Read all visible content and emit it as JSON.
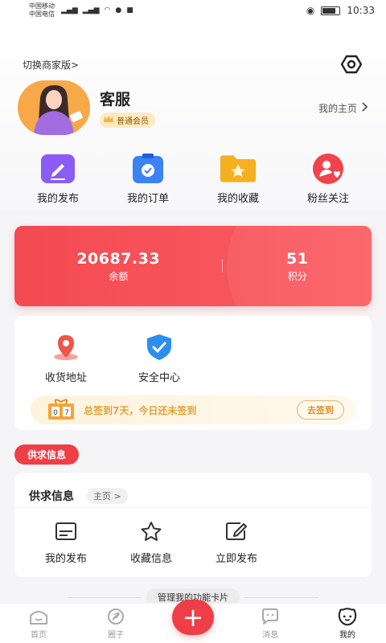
{
  "statusbar": {
    "carrier1": "中国移动",
    "carrier2": "中国电信",
    "time": "10:33"
  },
  "header": {
    "switch_label": "切换商家版>",
    "settings_icon": "settings-hexagon-icon"
  },
  "profile": {
    "name": "客服",
    "level": "普通会员",
    "home_link": "我的主页"
  },
  "quick": [
    {
      "label": "我的发布",
      "icon": "edit-icon",
      "color": "#8b5cf6"
    },
    {
      "label": "我的订单",
      "icon": "order-clipboard-icon",
      "color": "#3b82f6"
    },
    {
      "label": "我的收藏",
      "icon": "star-folder-icon",
      "color": "#f5b021"
    },
    {
      "label": "粉丝关注",
      "icon": "fans-heart-icon",
      "color": "#f0434b"
    }
  ],
  "wallet": {
    "balance_value": "20687.33",
    "balance_label": "余额",
    "points_value": "51",
    "points_label": "积分",
    "color": "#f44a52"
  },
  "services": [
    {
      "label": "收货地址",
      "icon": "location-pin-icon"
    },
    {
      "label": "安全中心",
      "icon": "shield-check-icon"
    }
  ],
  "signin": {
    "days_digits": "07",
    "text": "总签到7天，今日还未签到",
    "button": "去签到"
  },
  "section_tag": "供求信息",
  "supply": {
    "title": "供求信息",
    "home": "主页 >",
    "items": [
      {
        "label": "我的发布",
        "icon": "list-card-icon"
      },
      {
        "label": "收藏信息",
        "icon": "star-outline-icon"
      },
      {
        "label": "立即发布",
        "icon": "edit-outline-icon"
      }
    ]
  },
  "manage_cards": "管理我的功能卡片",
  "tabbar": {
    "items": [
      {
        "label": "首页",
        "icon": "home-icon"
      },
      {
        "label": "圈子",
        "icon": "circle-feather-icon"
      },
      {
        "label": "",
        "icon": "plus-icon"
      },
      {
        "label": "消息",
        "icon": "message-icon"
      },
      {
        "label": "我的",
        "icon": "profile-face-icon"
      }
    ]
  }
}
